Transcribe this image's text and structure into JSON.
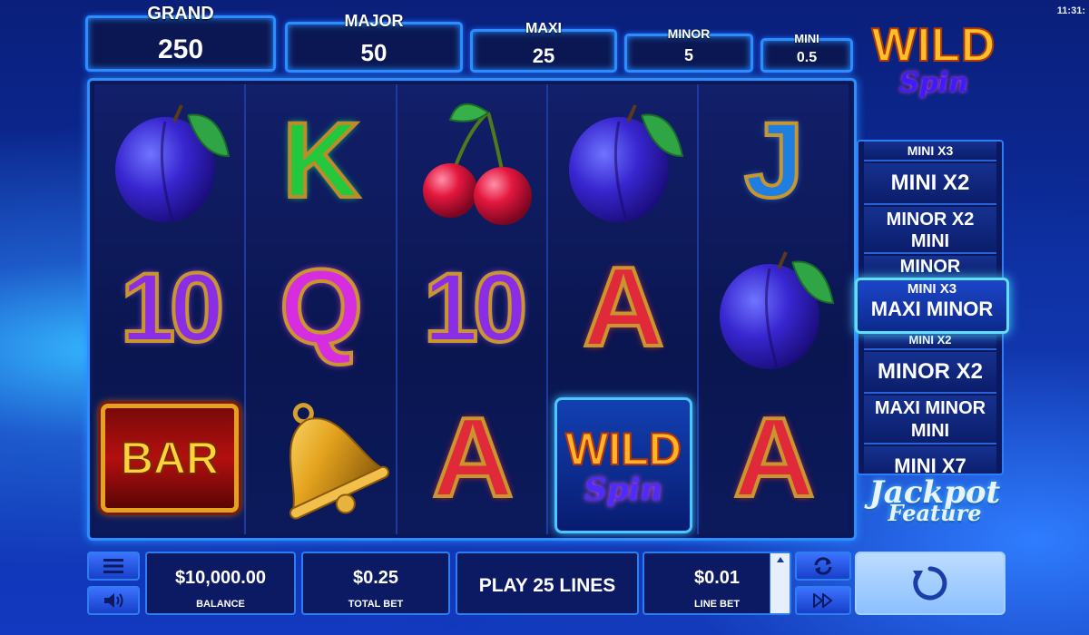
{
  "clock": "11:31:",
  "jackpots": [
    {
      "label": "GRAND",
      "value": "250"
    },
    {
      "label": "MAJOR",
      "value": "50"
    },
    {
      "label": "MAXI",
      "value": "25"
    },
    {
      "label": "MINOR",
      "value": "5"
    },
    {
      "label": "MINI",
      "value": "0.5"
    }
  ],
  "logo": {
    "line1": "WILD",
    "line2": "Spin"
  },
  "reels": [
    [
      {
        "type": "plum"
      },
      {
        "type": "ten",
        "text": "10"
      },
      {
        "type": "bar",
        "text": "BAR"
      }
    ],
    [
      {
        "type": "k",
        "text": "K"
      },
      {
        "type": "q",
        "text": "Q"
      },
      {
        "type": "bell"
      }
    ],
    [
      {
        "type": "cherry"
      },
      {
        "type": "ten",
        "text": "10"
      },
      {
        "type": "a",
        "text": "A"
      }
    ],
    [
      {
        "type": "plum"
      },
      {
        "type": "a",
        "text": "A"
      },
      {
        "type": "wild",
        "text": "WILD",
        "text2": "Spin"
      }
    ],
    [
      {
        "type": "j",
        "text": "J"
      },
      {
        "type": "plum"
      },
      {
        "type": "a",
        "text": "A"
      }
    ]
  ],
  "ladder": {
    "rungs": [
      "MINI X3",
      "MINI X2",
      "MINOR X2",
      "MINI",
      "MINOR",
      "MINOR X2",
      "MAXI  MINOR",
      "MINI",
      "MINI X7"
    ],
    "active_partial": "MINI X3",
    "active": "MAXI  MINOR",
    "partial_below": "MINI X2"
  },
  "jackpot_feature": {
    "line1": "Jackpot",
    "line2": "Feature"
  },
  "bottom": {
    "balance": {
      "value": "$10,000.00",
      "label": "BALANCE"
    },
    "total_bet": {
      "value": "$0.25",
      "label": "TOTAL BET"
    },
    "play_lines": "PLAY 25 LINES",
    "line_bet": {
      "value": "$0.01",
      "label": "LINE BET"
    }
  },
  "icons": {
    "menu": "menu-icon",
    "sound": "speaker-icon",
    "autoplay": "autoplay-icon",
    "fast": "fast-forward-icon",
    "spin": "spin-icon"
  }
}
